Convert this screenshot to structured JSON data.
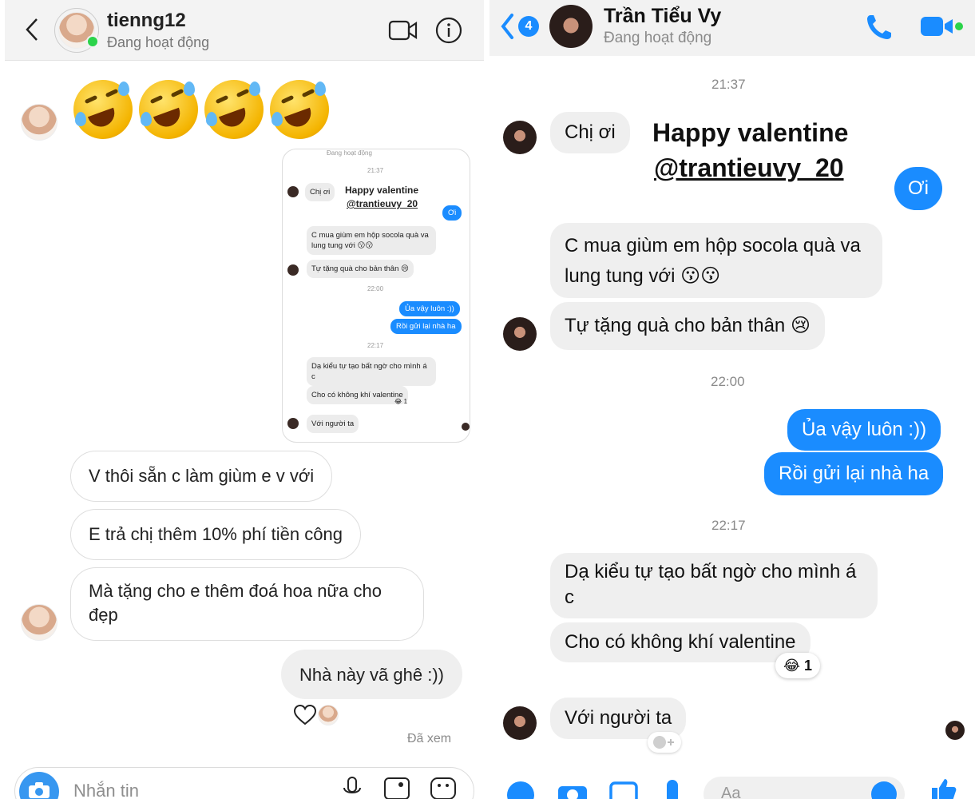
{
  "left": {
    "header": {
      "username": "tienng12",
      "status": "Đang hoạt động"
    },
    "emoji_row": [
      "rolling-on-floor-laughing",
      "rolling-on-floor-laughing",
      "rolling-on-floor-laughing",
      "rolling-on-floor-laughing"
    ],
    "shared_screenshot": {
      "status": "Đang hoạt động",
      "time1": "21:37",
      "msg_chi_oi": "Chị ơi",
      "caption_line1": "Happy valentine",
      "caption_line2": "@trantieuvy_20",
      "reply_oi": "Ơi",
      "msg_socola_1": "C mua giùm em hộp socola quà va",
      "msg_socola_2": "lung tung với 😗😗",
      "msg_tu_tang": "Tự tặng quà cho bản thân 😢",
      "time2": "22:00",
      "reply_ua": "Ủa vậy luôn :))",
      "reply_roi": "Rồi gửi lại nhà ha",
      "time3": "22:17",
      "msg_da_kieu_1": "Dạ kiểu tự tạo bất ngờ cho mình á",
      "msg_da_kieu_2": "c",
      "msg_cho_co": "Cho có không khí valentine",
      "reaction": "😂 1",
      "msg_voi": "Với người ta"
    },
    "messages": {
      "m1": "V thôi sẵn c làm giùm e v với",
      "m2": "E trả chị thêm 10% phí tiền công",
      "m3_line1": "Mà tặng cho e thêm đoá hoa nữa cho",
      "m3_line2": "đẹp",
      "own": "Nhà này vã ghê :))"
    },
    "seen": "Đã xem",
    "composer": {
      "placeholder": "Nhắn tin"
    }
  },
  "right": {
    "header": {
      "back_badge": "4",
      "name": "Trần Tiểu Vy",
      "status": "Đang hoạt động"
    },
    "time1": "21:37",
    "msg_chi_oi": "Chị ơi",
    "caption_line1": "Happy valentine",
    "caption_line2": "@trantieuvy_20",
    "reply_oi": "Ơi",
    "msg_socola_1": "C mua giùm em hộp socola quà va",
    "msg_socola_2": "lung tung với 😗😗",
    "msg_tu_tang": "Tự tặng quà cho bản thân 😢",
    "time2": "22:00",
    "reply_ua": "Ủa vậy luôn :))",
    "reply_roi": "Rồi gửi lại nhà ha",
    "time3": "22:17",
    "msg_da_kieu_1": "Dạ kiểu tự tạo bất ngờ cho mình á",
    "msg_da_kieu_2": "c",
    "msg_cho_co": "Cho có không khí valentine",
    "reaction_emoji": "😂",
    "reaction_count": "1",
    "msg_voi": "Với người ta",
    "composer_placeholder": "Aa"
  },
  "colors": {
    "messenger_blue": "#1a8cff",
    "online_green": "#2bd34a",
    "bubble_grey": "#efefef"
  }
}
